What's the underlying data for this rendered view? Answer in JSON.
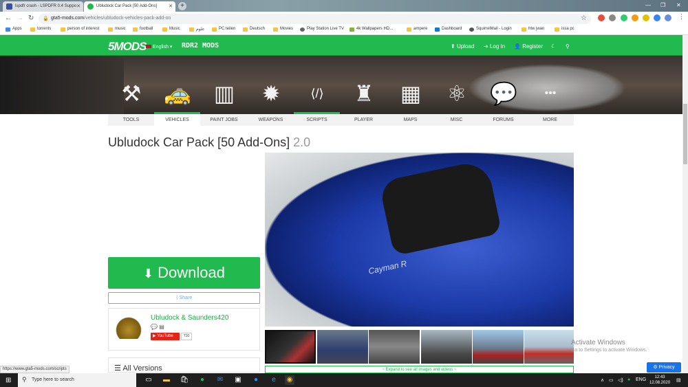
{
  "browser": {
    "tabs": [
      {
        "title": "lspdfr crash - LSPDFR 0.4 Suppo",
        "active": false
      },
      {
        "title": "Ubludock Car Pack [50 Add-Ons]",
        "active": true
      }
    ],
    "url_host": "gta5-mods.com",
    "url_path": "/vehicles/ubludock-vehicles-pack-add-on",
    "bookmarks": [
      "Apps",
      "torrents",
      "person of interest",
      "music",
      "football",
      "Music",
      "علوم",
      "PC teilen",
      "Deutsch",
      "Movies",
      "Play Station Live TV",
      "4k Wallpapers HD...",
      "ampere",
      "Dashboard",
      "SquirrelMail - Login",
      "htw jwan",
      "issa pc"
    ]
  },
  "site": {
    "logo": "5MODS",
    "language": "English",
    "rdr_logo": "RDR2 MODS",
    "upload": "Upload",
    "login": "Log In",
    "register": "Register"
  },
  "categories": [
    {
      "label": "TOOLS",
      "icon": "tools-icon",
      "glyph": "⚒",
      "selected": false
    },
    {
      "label": "VEHICLES",
      "icon": "car-icon",
      "glyph": "🚕",
      "selected": true
    },
    {
      "label": "PAINT JOBS",
      "icon": "paint-roller-icon",
      "glyph": "▥",
      "selected": false
    },
    {
      "label": "WEAPONS",
      "icon": "grenade-icon",
      "glyph": "✹",
      "selected": false
    },
    {
      "label": "SCRIPTS",
      "icon": "code-icon",
      "glyph": "⟨/⟩",
      "selected": true
    },
    {
      "label": "PLAYER",
      "icon": "jacket-icon",
      "glyph": "♜",
      "selected": false
    },
    {
      "label": "MAPS",
      "icon": "map-icon",
      "glyph": "▦",
      "selected": false
    },
    {
      "label": "MISC",
      "icon": "atom-icon",
      "glyph": "⚛",
      "selected": false
    },
    {
      "label": "FORUMS",
      "icon": "chat-bubbles-icon",
      "glyph": "💬",
      "selected": false
    },
    {
      "label": "MORE",
      "icon": "more-dots-icon",
      "glyph": "•••",
      "selected": false
    }
  ],
  "mod": {
    "title": "Ubludock Car Pack [50 Add-Ons]",
    "version": "2.0",
    "badge_text": "Cayman R"
  },
  "download": {
    "label": "Download",
    "share": "Share"
  },
  "author": {
    "name": "Ubludock & Saunders420",
    "youtube_label": "YouTube",
    "youtube_count": "710"
  },
  "all_versions": "All Versions",
  "expand_label": "~ Expand to see all images and videos ~",
  "windows": {
    "activate_title": "Activate Windows",
    "activate_text": "Go to Settings to activate Windows.",
    "privacy": "Privacy",
    "status_url": "https://www.gta5-mods.com/scripts",
    "search_placeholder": "Type here to search",
    "lang": "ENG",
    "time": "12:43",
    "date": "12.08.2020"
  },
  "colors": {
    "brand_green": "#20ba4e",
    "car_blue": "#1c3aa8",
    "youtube_red": "#e62117"
  }
}
